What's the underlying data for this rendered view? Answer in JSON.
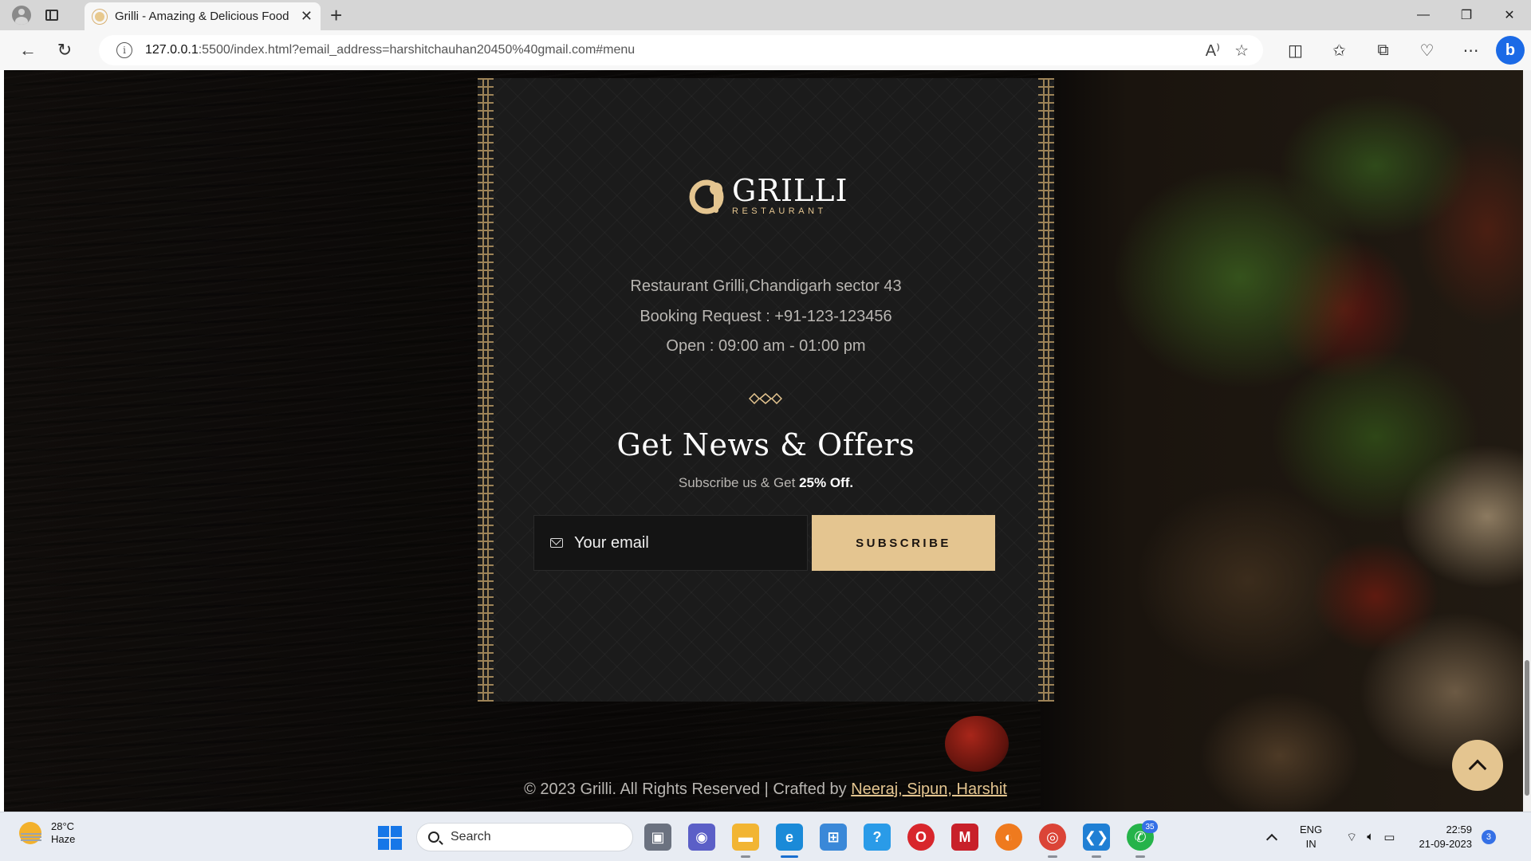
{
  "browser": {
    "tab_title": "Grilli - Amazing & Delicious Food",
    "url_host": "127.0.0.1",
    "url_rest": ":5500/index.html?email_address=harshitchauhan20450%40gmail.com#menu",
    "window_controls": {
      "minimize": "—",
      "restore": "❐",
      "close": "✕"
    },
    "new_tab": "+"
  },
  "site": {
    "logo_word": "GRILLI",
    "logo_sub": "RESTAURANT",
    "address_line": "Restaurant Grilli,Chandigarh sector 43",
    "booking_line": "Booking Request : +91-123-123456",
    "hours_line": "Open : 09:00 am - 01:00 pm",
    "news_title": "Get News & Offers",
    "news_sub_prefix": "Subscribe us & Get ",
    "news_sub_highlight": "25% Off.",
    "email_placeholder": "Your email",
    "subscribe_label": "SUBSCRIBE",
    "copyright_prefix": "© 2023 Grilli. All Rights Reserved | Crafted by ",
    "copyright_authors": "Neeraj, Sipun, Harshit",
    "accent_color": "#e4c590"
  },
  "taskbar": {
    "weather_temp": "28°C",
    "weather_desc": "Haze",
    "search_label": "Search",
    "whatsapp_badge": "35",
    "lang_top": "ENG",
    "lang_bottom": "IN",
    "time": "22:59",
    "date": "21-09-2023",
    "notifications": "3"
  }
}
